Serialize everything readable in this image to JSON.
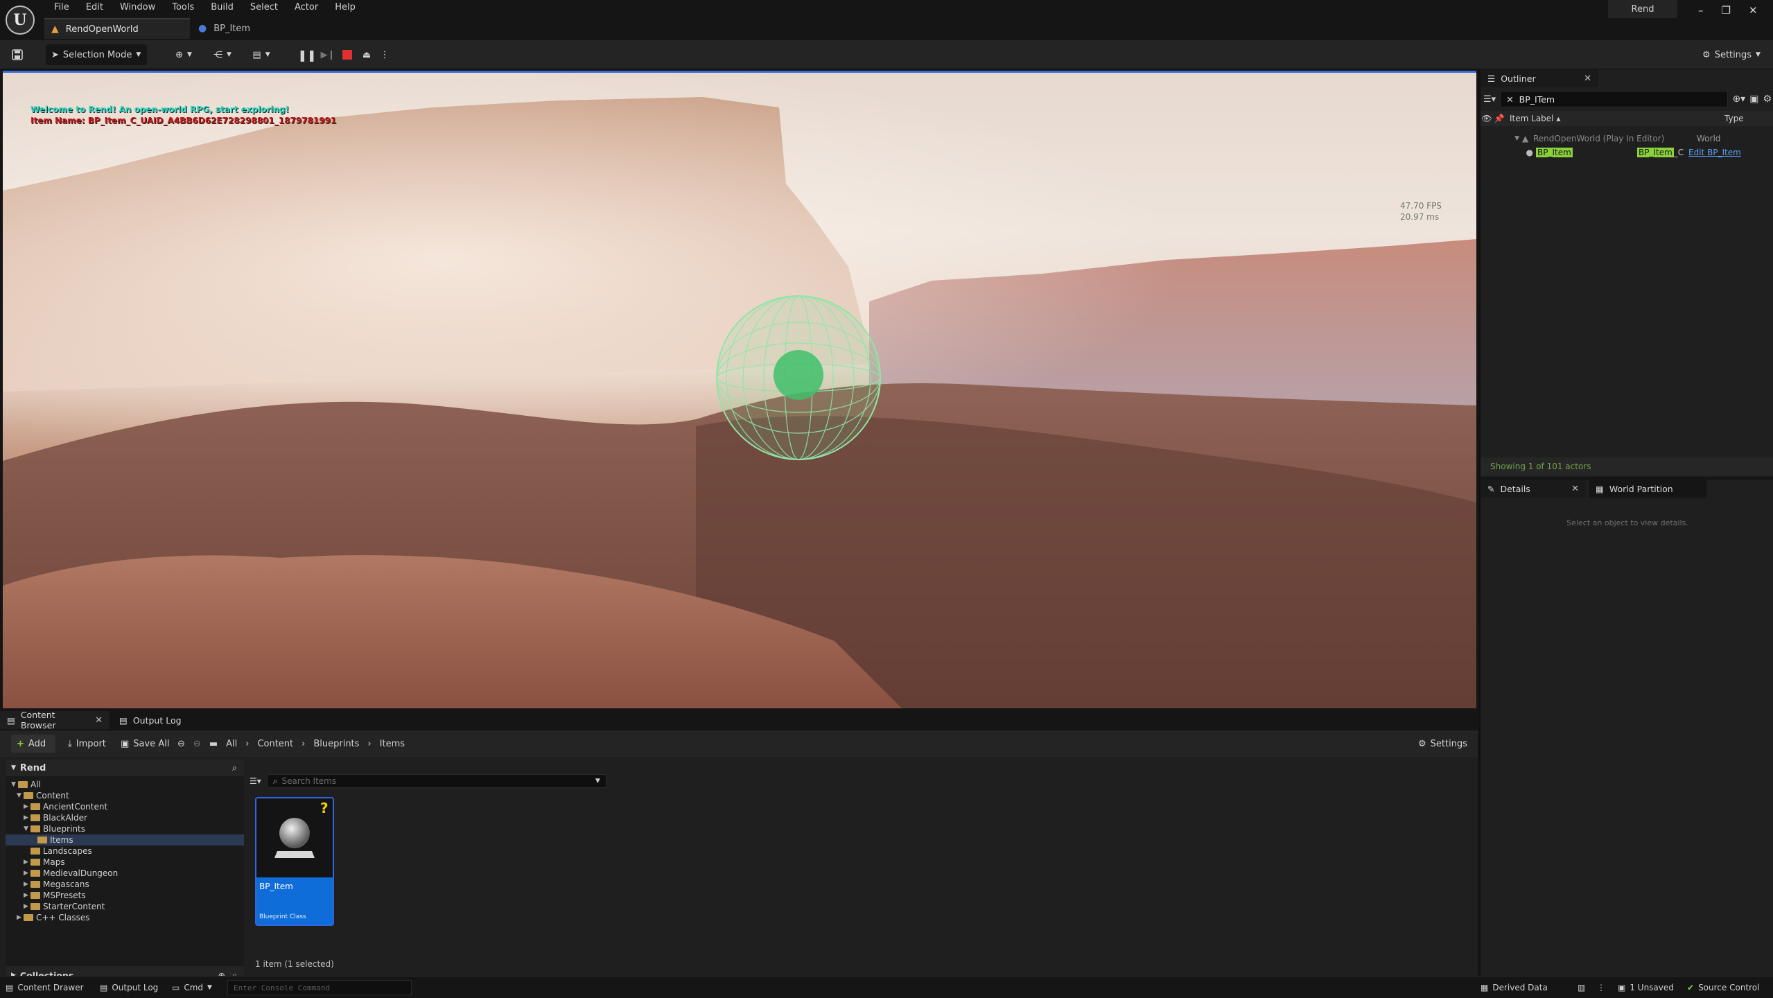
{
  "app": {
    "menu": [
      "File",
      "Edit",
      "Window",
      "Tools",
      "Build",
      "Select",
      "Actor",
      "Help"
    ],
    "tabs": [
      {
        "label": "RendOpenWorld",
        "icon": "level-icon"
      },
      {
        "label": "BP_Item",
        "icon": "blueprint-icon"
      }
    ],
    "project_name": "Rend",
    "window_controls": {
      "minimize": "–",
      "restore": "❐",
      "close": "✕"
    }
  },
  "toolbar": {
    "selection_mode": "Selection Mode",
    "settings": "Settings"
  },
  "viewport": {
    "hud_welcome": "Welcome to Rend! An open-world RPG, start exploring!",
    "hud_item_name": "Item Name: BP_Item_C_UAID_A4BB6D62E728298801_1879781991",
    "fps": "47.70 FPS",
    "frame_ms": "20.97 ms"
  },
  "outliner": {
    "tab_label": "Outliner",
    "search_value": "BP_ITem",
    "col_label": "Item Label ▴",
    "col_type": "Type",
    "rows": [
      {
        "label": "RendOpenWorld (Play In Editor)",
        "type": "World"
      },
      {
        "label": "BP_Item",
        "type_highlight": "BP_Item",
        "type_suffix": "_C",
        "edit_link": "Edit BP_Item"
      }
    ],
    "status": "Showing 1 of 101 actors"
  },
  "details": {
    "tab_label": "Details",
    "tab2_label": "World Partition",
    "empty_message": "Select an object to view details."
  },
  "content_browser": {
    "tab_label": "Content Browser",
    "tab2_label": "Output Log",
    "add": "Add",
    "import": "Import",
    "save_all": "Save All",
    "breadcrumbs": [
      "All",
      "Content",
      "Blueprints",
      "Items"
    ],
    "settings": "Settings",
    "tree_root": "Rend",
    "tree": [
      {
        "label": "All",
        "depth": 0,
        "expanded": true
      },
      {
        "label": "Content",
        "depth": 1,
        "expanded": true
      },
      {
        "label": "AncientContent",
        "depth": 2
      },
      {
        "label": "BlackAlder",
        "depth": 2
      },
      {
        "label": "Blueprints",
        "depth": 2,
        "expanded": true
      },
      {
        "label": "Items",
        "depth": 3,
        "selected": true
      },
      {
        "label": "Landscapes",
        "depth": 2
      },
      {
        "label": "Maps",
        "depth": 2
      },
      {
        "label": "MedievalDungeon",
        "depth": 2
      },
      {
        "label": "Megascans",
        "depth": 2
      },
      {
        "label": "MSPresets",
        "depth": 2
      },
      {
        "label": "StarterContent",
        "depth": 2
      },
      {
        "label": "C++ Classes",
        "depth": 1
      }
    ],
    "collections": "Collections",
    "search_placeholder": "Search Items",
    "asset": {
      "name": "BP_Item",
      "type": "Blueprint Class",
      "badge": "?"
    },
    "item_count": "1 item (1 selected)"
  },
  "statusbar": {
    "content_drawer": "Content Drawer",
    "output_log": "Output Log",
    "cmd": "Cmd",
    "console_placeholder": "Enter Console Command",
    "derived_data": "Derived Data",
    "unsaved": "1 Unsaved",
    "source_control": "Source Control"
  },
  "colors": {
    "accent_blue": "#2f66e0",
    "highlight_green": "#8bd13a",
    "hud_cyan": "#2ad6c0",
    "hud_red": "#c81818",
    "stop_red": "#e03030"
  }
}
